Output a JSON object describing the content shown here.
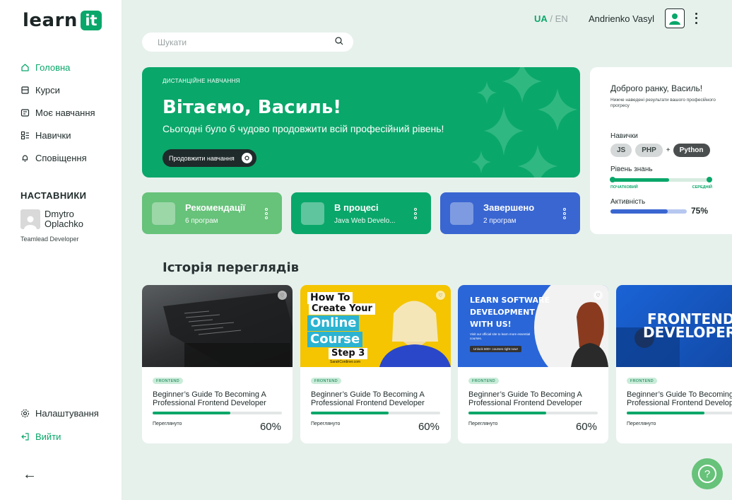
{
  "brand": {
    "word": "learn",
    "badge": "it"
  },
  "nav": {
    "items": [
      {
        "label": "Головна",
        "icon": "home-icon"
      },
      {
        "label": "Курси",
        "icon": "book-icon"
      },
      {
        "label": "Моє навчання",
        "icon": "learning-icon"
      },
      {
        "label": "Навички",
        "icon": "skills-icon"
      },
      {
        "label": "Сповіщення",
        "icon": "bell-icon"
      }
    ],
    "settings": "Налаштування",
    "logout": "Вийти"
  },
  "mentors": {
    "title": "НАСТАВНИКИ",
    "name_line1": "Dmytro",
    "name_line2": "Oplachko",
    "role": "Teamlead  Developer"
  },
  "search": {
    "placeholder": "Шукати"
  },
  "lang": {
    "active": "UA",
    "separator": "/",
    "other": "EN"
  },
  "user": {
    "name": "Andrienko Vasyl"
  },
  "hero": {
    "kicker": "ДИСТАНЦІЙНЕ НАВЧАННЯ",
    "title": "Вітаємо, Василь!",
    "subtitle": "Сьогодні було б чудово продовжити всій професійний рівень!",
    "button": "Продовжити навчання"
  },
  "status_cards": [
    {
      "title": "Рекомендації",
      "subtitle": "6 програм"
    },
    {
      "title": "В процесі",
      "subtitle": "Java Web Develo..."
    },
    {
      "title": "Завершено",
      "subtitle": "2 програм"
    }
  ],
  "panel": {
    "greeting": "Доброго ранку, Василь!",
    "note": "Нижче наведені результати вашого професійного прогресу",
    "skills_label": "Навички",
    "skills": [
      "JS",
      "PHP",
      "Python"
    ],
    "plus": "+",
    "level_label": "Рівень знань",
    "level_from": "ПОЧАТКОВИЙ",
    "level_to": "СЕРЕДНІЙ",
    "level_progress": 0.58,
    "activity_label": "Активність",
    "activity_value": "75%",
    "activity_progress": 0.75
  },
  "history": {
    "title": "Історія переглядів",
    "courses": [
      {
        "tag": "FRONTEND",
        "title": "Beginner’s Guide To Becoming A Professional Frontend Developer",
        "label": "Переглянуто",
        "percent": "60%",
        "progress": 0.6
      },
      {
        "tag": "FRONTEND",
        "title": "Beginner’s Guide To Becoming A Professional Frontend Developer",
        "label": "Переглянуто",
        "percent": "60%",
        "progress": 0.6,
        "thumb": {
          "l1": "How To",
          "l2": "Create Your",
          "l3": "Online",
          "l4": "Course",
          "l5": "Step 3",
          "site": "SarahCordiner.com"
        }
      },
      {
        "tag": "FRONTEND",
        "title": "Beginner’s Guide To Becoming A Professional Frontend Developer",
        "label": "Переглянуто",
        "percent": "60%",
        "progress": 0.6,
        "thumb": {
          "l1": "LEARN SOFTWARE",
          "l2": "DEVELOPMENT",
          "l3": "WITH US!",
          "small": "Visit our official site to learn more essential courses.",
          "pill": "Unlock 600+ courses right now!"
        }
      },
      {
        "tag": "FRONTEND",
        "title": "Beginner’s Guide To Becoming A Professional Frontend Developer",
        "label": "Переглянуто",
        "percent": "",
        "progress": 0.6,
        "thumb": {
          "l1": "FRONTEND",
          "l2": "DEVELOPER"
        }
      }
    ]
  },
  "colors": {
    "accent": "#0aa76a",
    "light_green": "#67c27a",
    "blue": "#3a66d1",
    "background": "#e7f1ec"
  }
}
